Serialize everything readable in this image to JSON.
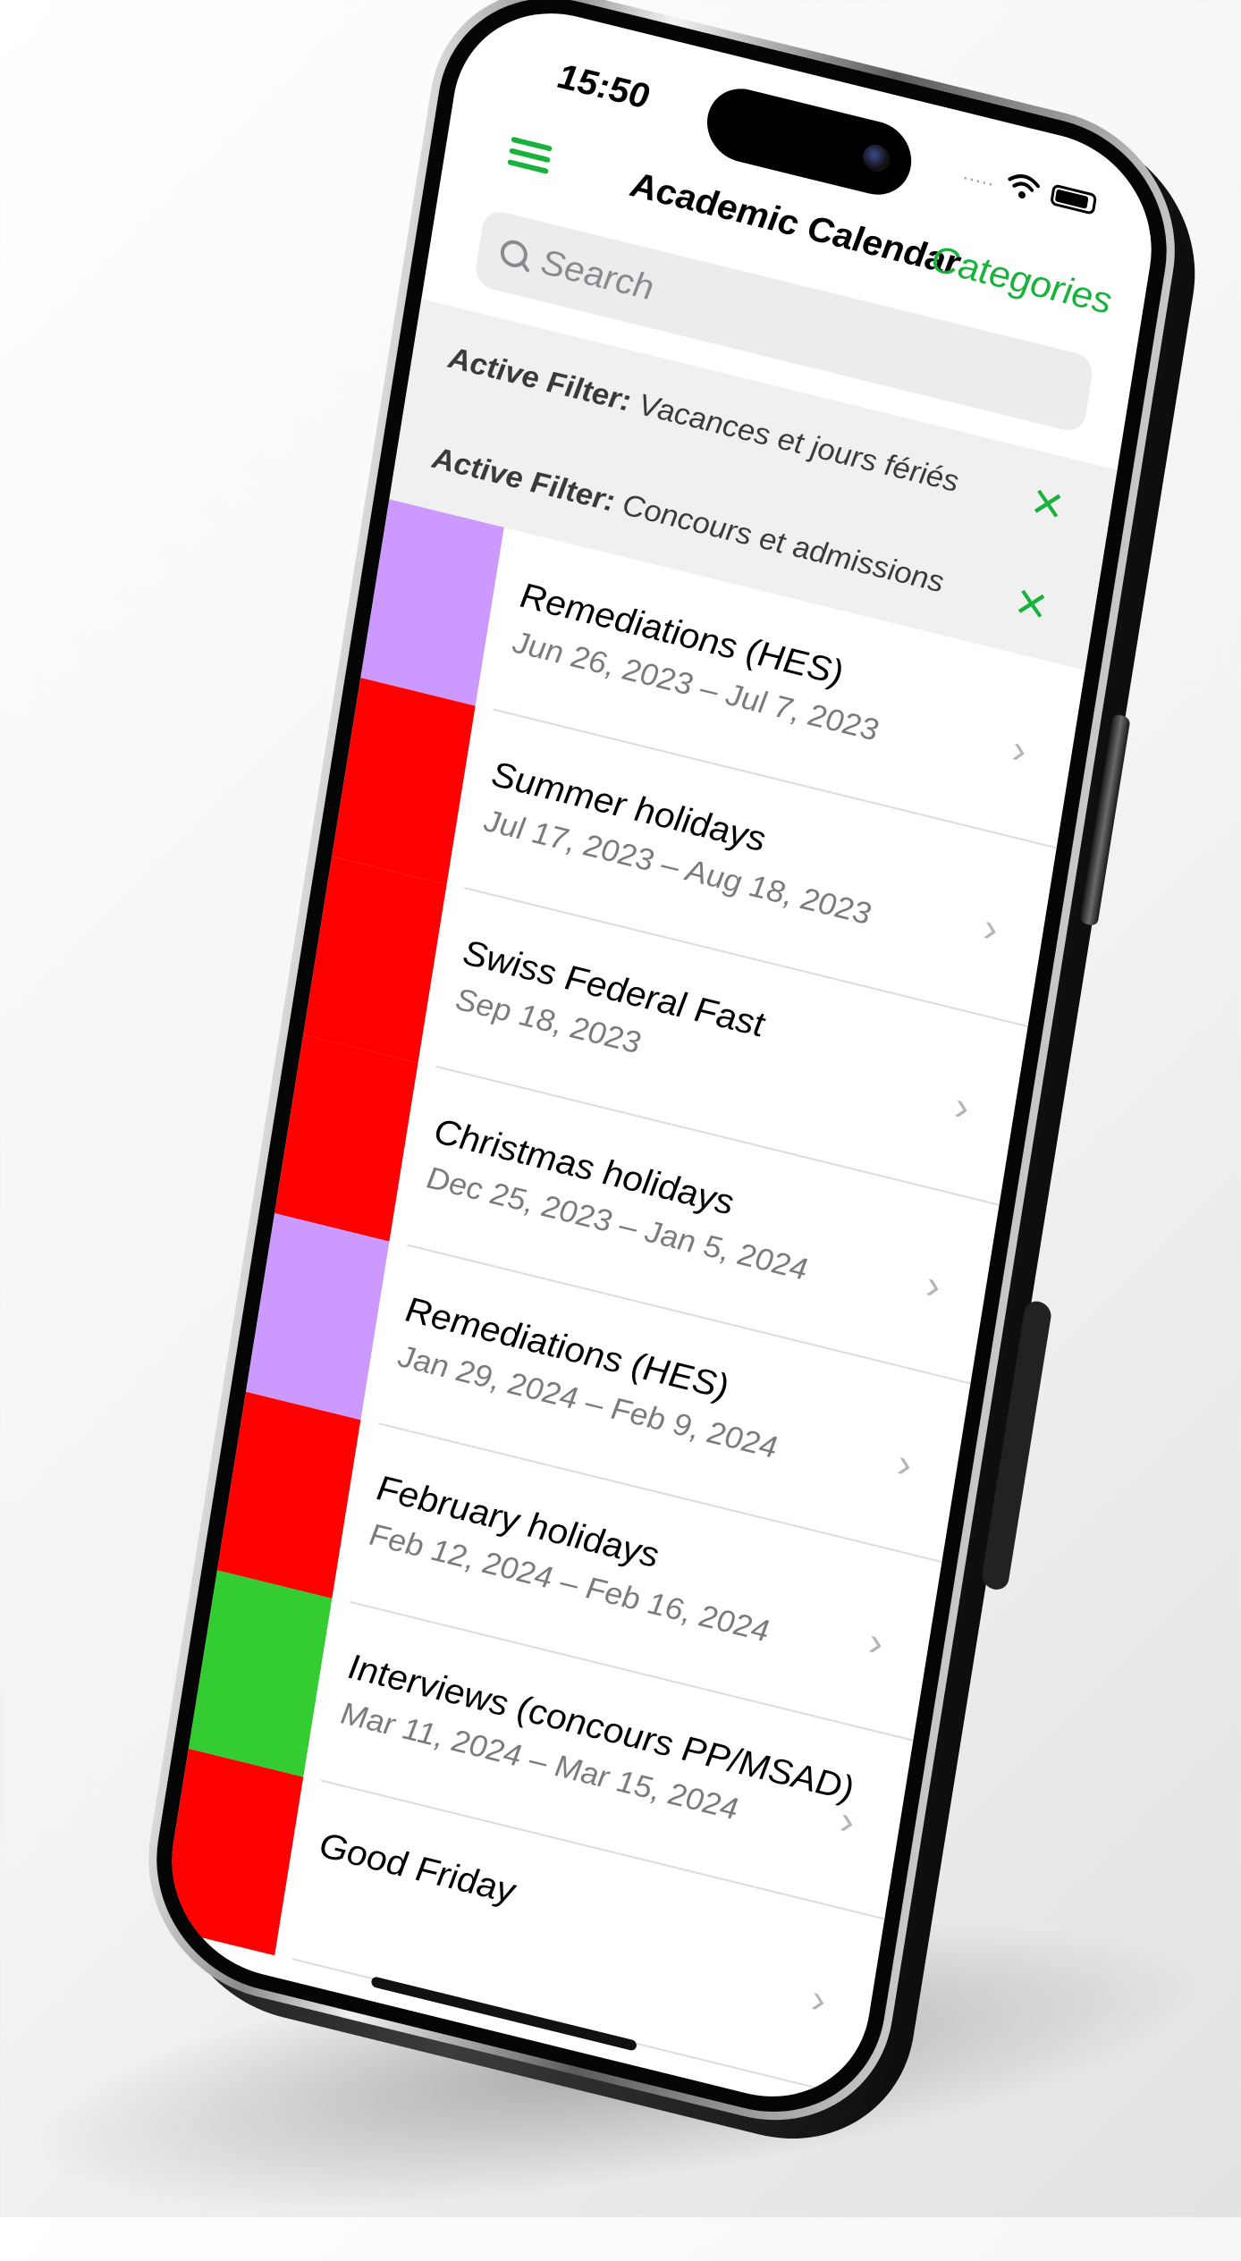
{
  "status_bar": {
    "time": "15:50",
    "signal": "....."
  },
  "nav": {
    "title": "Academic Calendar",
    "categories_label": "Categories"
  },
  "search": {
    "placeholder": "Search"
  },
  "filters": [
    {
      "prefix": "Active Filter:",
      "value": "Vacances et jours fériés"
    },
    {
      "prefix": "Active Filter:",
      "value": "Concours et admissions"
    }
  ],
  "events": [
    {
      "title": "Remediations (HES)",
      "date": "Jun 26, 2023 – Jul 7, 2023",
      "color": "#cc99ff"
    },
    {
      "title": "Summer holidays",
      "date": "Jul 17, 2023 – Aug 18, 2023",
      "color": "#ff0000"
    },
    {
      "title": "Swiss Federal Fast",
      "date": "Sep 18, 2023",
      "color": "#ff0000"
    },
    {
      "title": "Christmas holidays",
      "date": "Dec 25, 2023 – Jan 5, 2024",
      "color": "#ff0000"
    },
    {
      "title": "Remediations (HES)",
      "date": "Jan 29, 2024 – Feb 9, 2024",
      "color": "#cc99ff"
    },
    {
      "title": "February holidays",
      "date": "Feb 12, 2024 – Feb 16, 2024",
      "color": "#ff0000"
    },
    {
      "title": "Interviews (concours PP/MSAD)",
      "date": "Mar 11, 2024 – Mar 15, 2024",
      "color": "#33cc33"
    },
    {
      "title": "Good Friday",
      "date": "",
      "color": "#ff0000"
    }
  ],
  "colors": {
    "accent": "#19b23c"
  }
}
